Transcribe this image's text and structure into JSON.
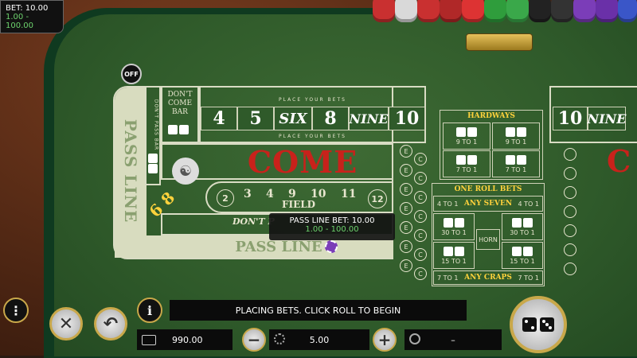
{
  "bet_info": {
    "bet_label": "BET: 10.00",
    "range": "1.00 - 100.00"
  },
  "table": {
    "off_puck": "OFF",
    "dont_come_bar": "DON'T COME BAR",
    "dont_pass_bar": "DON'T PASS BAR",
    "place_your_bets": "PLACE YOUR BETS",
    "numbers": [
      "4",
      "5",
      "SIX",
      "8",
      "NINE",
      "10"
    ],
    "numbers_right": [
      "10",
      "NINE"
    ],
    "come": "COME",
    "pass_line_vertical": "PASS LINE",
    "pass_line": "PASS LINE",
    "big_68": "6 8",
    "big_label": "BIG",
    "field_numbers": [
      "2",
      "3",
      "4",
      "9",
      "10",
      "11",
      "12"
    ],
    "field": "FIELD",
    "dont_pass": "DON'T P",
    "e_labels": [
      "E",
      "C",
      "E",
      "C",
      "E",
      "C",
      "E",
      "C",
      "E",
      "C",
      "E",
      "C",
      "E",
      "C"
    ],
    "hardways": {
      "title": "HARDWAYS",
      "payouts": [
        "9 TO 1",
        "7 TO 1",
        "9 TO 1",
        "7 TO 1"
      ]
    },
    "one_roll": {
      "title": "ONE ROLL BETS",
      "any_seven_left": "4 TO 1",
      "any_seven": "ANY SEVEN",
      "any_seven_right": "4 TO 1",
      "payouts": [
        "30 TO 1",
        "30 TO 1",
        "15 TO 1",
        "15 TO 1"
      ],
      "horn": "HORN",
      "any_craps_left": "7 TO 1",
      "any_craps": "ANY CRAPS",
      "any_craps_right": "7 TO 1"
    }
  },
  "tooltip": {
    "label": "PASS LINE BET: 10.00",
    "range": "1.00 - 100.00"
  },
  "controls": {
    "status_message": "PLACING BETS. CLICK ROLL TO BEGIN",
    "balance": "990.00",
    "chip_value": "5.00",
    "last_win": "–"
  },
  "colors": {
    "felt": "#2f5a2a",
    "accent_red": "#c8221b",
    "gold": "#ffd23c",
    "range_green": "#6dd36d"
  }
}
